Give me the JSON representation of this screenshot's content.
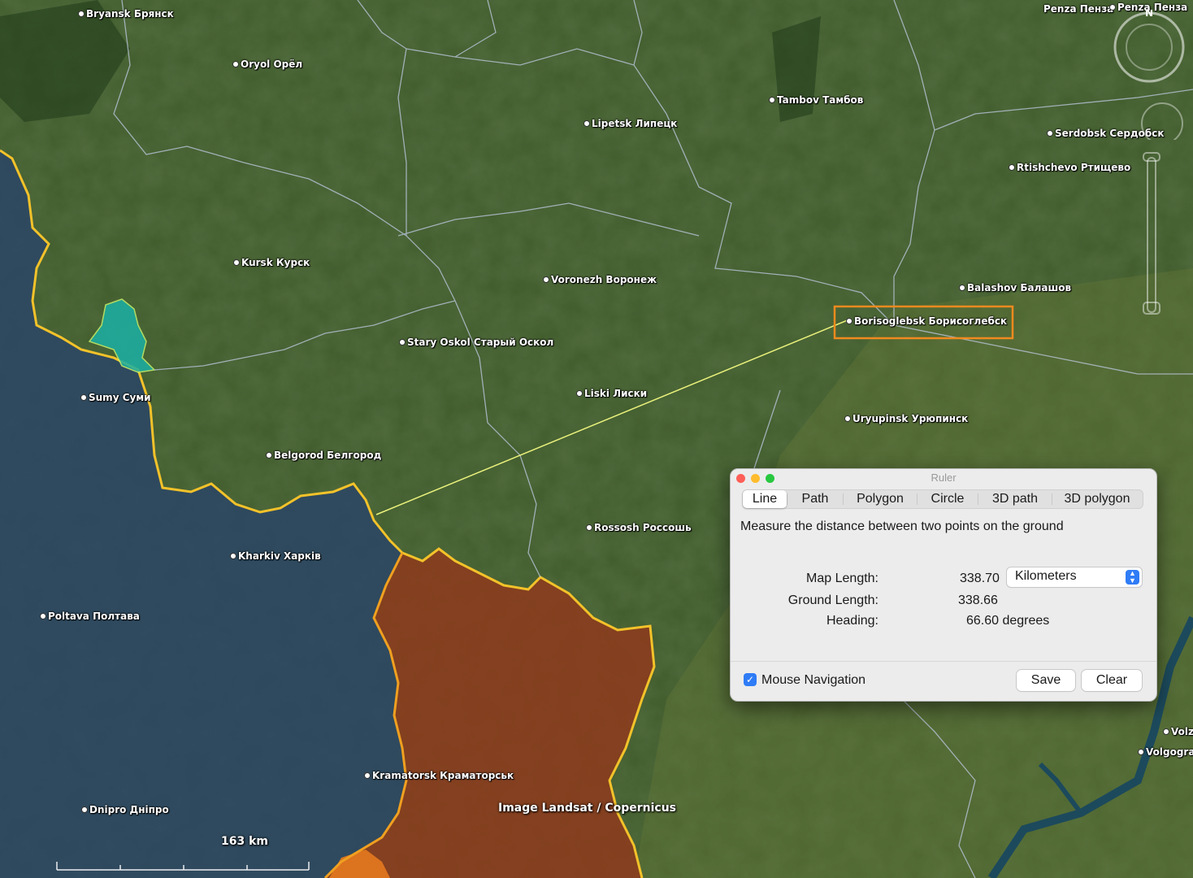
{
  "places": [
    {
      "name": "Bryansk Брянск"
    },
    {
      "name": "Oryol Орёл"
    },
    {
      "name": "Tambov Тамбов"
    },
    {
      "name": "Lipetsk Липецк"
    },
    {
      "name": "Serdobsk Сердобск"
    },
    {
      "name": "Rtishchevo Ртищево"
    },
    {
      "name": "Kursk Курск"
    },
    {
      "name": "Voronezh Воронеж"
    },
    {
      "name": "Balashov Балашов"
    },
    {
      "name": "Borisoglebsk Борисоглебск"
    },
    {
      "name": "Stary Oskol Старый Оскол"
    },
    {
      "name": "Liski Лиски"
    },
    {
      "name": "Sumy Суми"
    },
    {
      "name": "Uryupinsk Урюпинск"
    },
    {
      "name": "Belgorod Белгород"
    },
    {
      "name": "Rossosh Россошь"
    },
    {
      "name": "Kharkiv Харків"
    },
    {
      "name": "Poltava Полтава"
    },
    {
      "name": "Kramatorsk Краматорськ"
    },
    {
      "name": "Dnipro Дніпро"
    },
    {
      "name": "Volgogra"
    },
    {
      "name": "Volz"
    },
    {
      "name": "Penza Пенза"
    },
    {
      "name": "Penza Пенза"
    }
  ],
  "map": {
    "image_credit": "Image Landsat / Copernicus",
    "scale_label": "163 km",
    "compass_letter": "N",
    "colors": {
      "russia_land": "#3f5a2a",
      "ukraine_overlay": "#2b4260",
      "occupied_overlay": "#8a3a1e",
      "border_line": "#f5c62a",
      "highlight": "#f08a1e",
      "measure_line": "#e8f27a",
      "kursk_incursion": "#1aa8a0"
    }
  },
  "ruler": {
    "title": "Ruler",
    "tabs": [
      "Line",
      "Path",
      "Polygon",
      "Circle",
      "3D path",
      "3D polygon"
    ],
    "active_tab": "Line",
    "description": "Measure the distance between two points on the ground",
    "map_length_label": "Map Length:",
    "map_length_value": "338.70",
    "unit": "Kilometers",
    "ground_length_label": "Ground Length:",
    "ground_length_value": "338.66",
    "heading_label": "Heading:",
    "heading_value": "66.60 degrees",
    "mouse_nav_label": "Mouse Navigation",
    "mouse_nav_checked": true,
    "save_label": "Save",
    "clear_label": "Clear"
  }
}
